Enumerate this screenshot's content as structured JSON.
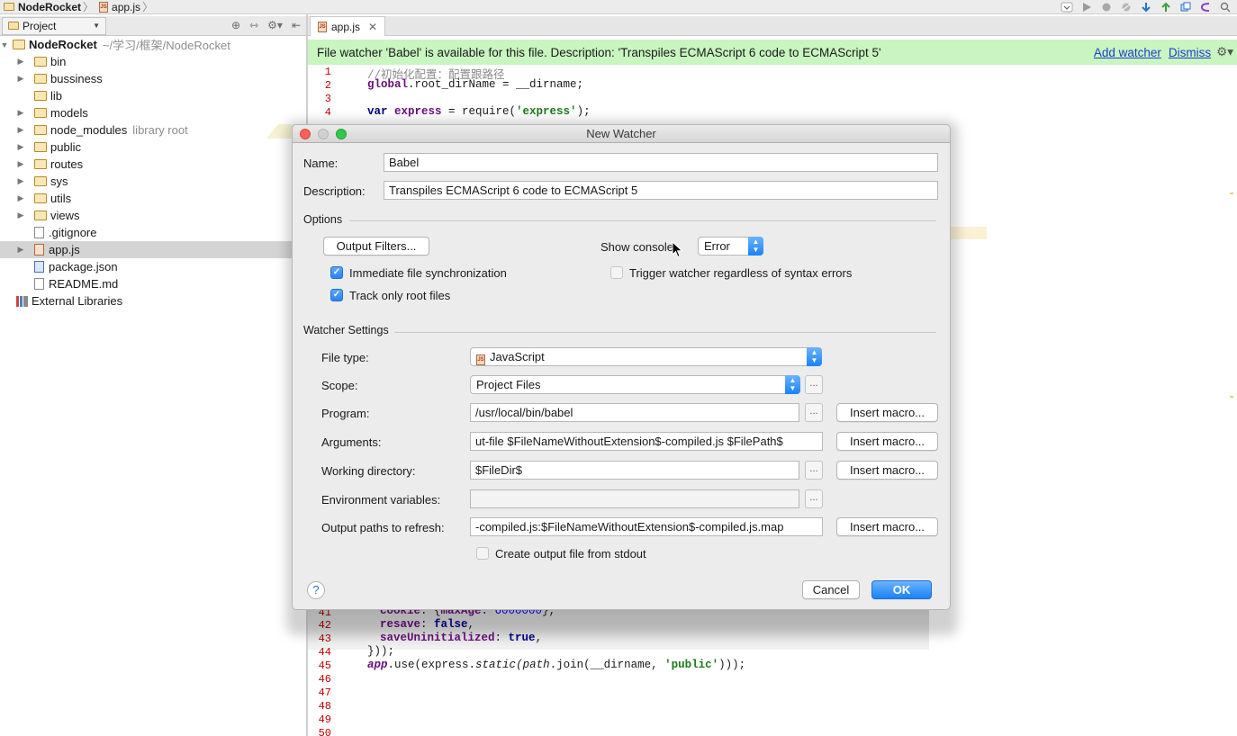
{
  "breadcrumb": {
    "project": "NodeRocket",
    "file": "app.js"
  },
  "project_panel": {
    "tab_label": "Project",
    "root": {
      "name": "NodeRocket",
      "path": "~/学习/框架/NodeRocket"
    },
    "items": [
      {
        "label": "bin",
        "type": "folder",
        "expandable": true
      },
      {
        "label": "bussiness",
        "type": "folder",
        "expandable": true
      },
      {
        "label": "lib",
        "type": "folder",
        "expandable": false
      },
      {
        "label": "models",
        "type": "folder",
        "expandable": true
      },
      {
        "label": "node_modules",
        "type": "folder",
        "expandable": true,
        "note": "library root"
      },
      {
        "label": "public",
        "type": "folder",
        "expandable": true
      },
      {
        "label": "routes",
        "type": "folder",
        "expandable": true
      },
      {
        "label": "sys",
        "type": "folder",
        "expandable": true
      },
      {
        "label": "utils",
        "type": "folder",
        "expandable": true
      },
      {
        "label": "views",
        "type": "folder",
        "expandable": true
      },
      {
        "label": ".gitignore",
        "type": "file"
      },
      {
        "label": "app.js",
        "type": "js",
        "selected": true
      },
      {
        "label": "package.json",
        "type": "json"
      },
      {
        "label": "README.md",
        "type": "file"
      }
    ],
    "external": "External Libraries"
  },
  "editor": {
    "tab_label": "app.js",
    "banner": {
      "text": "File watcher 'Babel' is available for this file. Description: 'Transpiles ECMAScript 6 code to ECMAScript 5'",
      "add_watcher": "Add watcher",
      "dismiss": "Dismiss"
    },
    "top_line_numbers": [
      "1",
      "2",
      "3",
      "4"
    ],
    "bottom_line_numbers": [
      "41",
      "42",
      "43",
      "44",
      "45",
      "46",
      "47",
      "48",
      "49",
      "50"
    ],
    "code": {
      "l1": "//初始化配置：配置跟路径",
      "l2_obj": "global",
      "l2_rest": ".root_dirName = __dirname;",
      "l4_kw": "var",
      "l4_var": " express",
      "l4_eq": " = require(",
      "l4_str": "'express'",
      "l4_end": ");",
      "l41_prop": "cookie",
      "l41_rest": ": {",
      "l41_prop2": "maxAge",
      "l41_num": ": 6000000",
      "l41_end": "},",
      "l42_prop": "resave",
      "l42_rest": ": ",
      "l42_kw": "false",
      "l42_end": ",",
      "l43_prop": "saveUninitialized",
      "l43_rest": ": ",
      "l43_kw": "true",
      "l43_end": ",",
      "l44": "}));",
      "l45_app": "app",
      "l45_use": ".use(express.",
      "l45_static": "static",
      "l45_path": "(path",
      "l45_join": ".join(",
      "l45_dir": "__dirname, ",
      "l45_str": "'public'",
      "l45_end": ")));"
    }
  },
  "dialog": {
    "title": "New Watcher",
    "name_label": "Name:",
    "name_value": "Babel",
    "description_label": "Description:",
    "description_value": "Transpiles ECMAScript 6 code to ECMAScript 5",
    "options_section": "Options",
    "output_filters_button": "Output Filters...",
    "show_console_label": "Show console:",
    "show_console_value": "Error",
    "immediate_sync_label": "Immediate file synchronization",
    "immediate_sync_checked": true,
    "track_root_label": "Track only root files",
    "track_root_checked": true,
    "trigger_regardless_label": "Trigger watcher regardless of syntax errors",
    "trigger_regardless_checked": false,
    "watcher_settings_section": "Watcher Settings",
    "file_type_label": "File type:",
    "file_type_value": "JavaScript",
    "scope_label": "Scope:",
    "scope_value": "Project Files",
    "program_label": "Program:",
    "program_value": "/usr/local/bin/babel",
    "arguments_label": "Arguments:",
    "arguments_value": "ut-file $FileNameWithoutExtension$-compiled.js $FilePath$",
    "working_dir_label": "Working directory:",
    "working_dir_value": "$FileDir$",
    "env_vars_label": "Environment variables:",
    "env_vars_value": "",
    "output_paths_label": "Output paths to refresh:",
    "output_paths_value": "-compiled.js:$FileNameWithoutExtension$-compiled.js.map",
    "create_output_label": "Create output file from stdout",
    "create_output_checked": false,
    "insert_macro_label": "Insert macro...",
    "ellipsis_label": "...",
    "help_label": "?",
    "cancel_label": "Cancel",
    "ok_label": "OK"
  }
}
